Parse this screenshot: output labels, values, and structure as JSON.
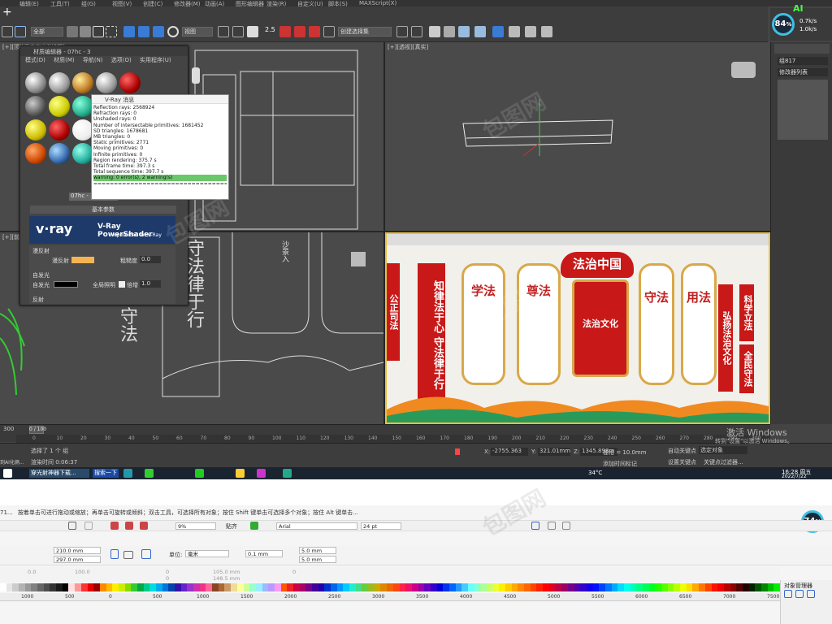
{
  "max": {
    "topbar": [
      "编辑(E)",
      "工具(T)",
      "组(G)",
      "视图(V)",
      "创建(C)",
      "修改器(M)",
      "动画(A)",
      "图形编辑器",
      "渲染(R)",
      "自定义(U)",
      "脚本(S)",
      "MAXScript(X)"
    ],
    "add_tab": "+",
    "selection_filter": "全部",
    "ref_coord": "视图",
    "named_selection": "创建选择集",
    "ai_label": "AI",
    "perf": {
      "percent": "84",
      "unit": "%",
      "up": "0.7k/s",
      "down": "1.0k/s"
    },
    "viewports": {
      "tl": "[+][顶][用户定义][线框]",
      "tr": "[+][透视][真实]",
      "bl": "[+][前][用户定义][线框]",
      "br": "[+][透视][真实]"
    },
    "command_panel": {
      "object_name": "组817",
      "modifier_list": "修改器列表"
    },
    "material_editor": {
      "title": "材质编辑器 - 07hc - 3",
      "menu": [
        "模式(D)",
        "材质(M)",
        "导航(N)",
        "选项(O)",
        "实用程序(U)"
      ],
      "slot_name": "07hc - 3",
      "basic_params": "基本参数",
      "diffuse_group": "漫反射",
      "diffuse_label": "漫反射",
      "roughness_label": "粗糙度",
      "roughness_value": "0.0",
      "self_illum_group": "自发光",
      "self_illum_label": "自发光",
      "gi_label": "全局照明",
      "multiplier_label": "倍增",
      "multiplier_value": "1.0",
      "reflection_group": "反射",
      "diffuse_color": "#f5b454"
    },
    "vray_message": {
      "title": "V-Ray 消息",
      "lines": [
        "Reflection rays: 2568924",
        "Refraction rays: 0",
        "Unshaded rays: 0",
        "Number of intersectable primitives: 1681452",
        "SD triangles: 1678681",
        "MB triangles: 0",
        "Static primitives: 2771",
        "Moving primitives: 0",
        "Infinite primitives: 0",
        "Region rendering: 375.7 s",
        "Total frame time: 397.3 s",
        "Total sequence time: 397.7 s"
      ],
      "warning": "warning: 0 error(s), 2 warning(s)",
      "separator": "=================================="
    },
    "vray_banner": {
      "logo": "v·ray",
      "product": "V-Ray PowerShader",
      "sub": "optimized for V-Ray"
    },
    "scene_text": {
      "top": "守法",
      "mid": "守法律于行",
      "label": "沙景入"
    },
    "board": {
      "header": "法治中国",
      "cols": [
        "学法",
        "尊法",
        "守法",
        "用法"
      ],
      "center": "法治文化",
      "left_bar": "知律法于心 守法律于行",
      "right_bar1": "弘扬法治文化",
      "right_bar2": "科学立法",
      "right_bar3": "全民守法",
      "edge_left": "公正司法"
    },
    "timeline": {
      "frame": "0 / 100",
      "ticks": [
        "0",
        "10",
        "20",
        "30",
        "40",
        "50",
        "60",
        "70",
        "80",
        "90",
        "100",
        "110",
        "120",
        "130",
        "140",
        "150",
        "160",
        "170",
        "180",
        "190",
        "200",
        "210",
        "220",
        "230",
        "240",
        "250",
        "260",
        "270",
        "280",
        "290",
        "300"
      ],
      "left_val": "300"
    },
    "status": {
      "selected": "选择了 1 个 组",
      "render_time": "渲染时间 0:06:37",
      "x_label": "X:",
      "x": "-2755.363",
      "y_label": "Y:",
      "y": "321.01mm",
      "z_label": "Z:",
      "z": "1345.898m",
      "grid": "栅格 = 10.0mm",
      "add_time_tag": "添加时间标记",
      "auto_key": "自动关键点",
      "selected_obj": "选定对象",
      "set_key": "设置关键点",
      "key_filter": "关键点过滤器...",
      "left_tag": "到AI化俩..."
    },
    "watermark_win": {
      "line1": "激活 Windows",
      "line2": "转到\"设置\"以激活 Windows。"
    },
    "taskbar": {
      "search": "搜索一下",
      "app": "穿光射神器下载...",
      "weather": "34°C",
      "time": "16:28 周五",
      "date": "2022/7/22"
    }
  },
  "cdr": {
    "hint": "按着单击可进行拖动或缩放；再单击可旋转或倾斜；双击工具，可选择所有对象；按住 Shift 键单击可选择多个对象；按住 Alt 键单击...",
    "hint_prefix": "71...",
    "zoom": "9%",
    "snap": "贴齐",
    "font": "Arial",
    "font_size": "24 pt",
    "width": "210.0 mm",
    "height": "297.0 mm",
    "unit_label": "单位:",
    "unit": "毫米",
    "nudge": "0.1 mm",
    "dup_x": "5.0 mm",
    "dup_y": "5.0 mm",
    "pos_values": [
      "0.0",
      "100.0",
      "0",
      "0",
      "105.0 mm",
      "148.5 mm",
      "0"
    ],
    "ruler": [
      "1000",
      "500",
      "0",
      "500",
      "1000",
      "1500",
      "2000",
      "2500",
      "3000",
      "3500",
      "4000",
      "4500",
      "5000",
      "5500",
      "6000",
      "6500",
      "7000",
      "7500"
    ],
    "gauge": "74",
    "gauge_unit": "%",
    "object_manager": "对象管理器"
  },
  "palette": [
    "#ffffff",
    "#e6e6e6",
    "#cccccc",
    "#b3b3b3",
    "#999999",
    "#808080",
    "#666666",
    "#4d4d4d",
    "#333333",
    "#1a1a1a",
    "#000000",
    "#ffe0e0",
    "#ff9999",
    "#ff3333",
    "#e60000",
    "#990000",
    "#ff8800",
    "#ffbb00",
    "#ffee00",
    "#ccee00",
    "#88dd00",
    "#33cc33",
    "#00aa44",
    "#00cc88",
    "#00dddd",
    "#00aaee",
    "#0077dd",
    "#0044aa",
    "#3311aa",
    "#6622cc",
    "#9933cc",
    "#cc33aa",
    "#ee3388",
    "#ff6699",
    "#884422",
    "#aa6633",
    "#cc9966",
    "#eedd99",
    "#ffff99",
    "#ccff99",
    "#99ffcc",
    "#99eeff",
    "#99bbff",
    "#bb99ff",
    "#ff99ee",
    "#ff5500",
    "#ee2222",
    "#cc0044",
    "#aa0066",
    "#770088",
    "#440099",
    "#2200aa",
    "#0033cc",
    "#0066ee",
    "#0099ff",
    "#00ccff",
    "#22eecc",
    "#44dd88",
    "#66cc44",
    "#99bb22",
    "#ccaa00",
    "#dd8800",
    "#ee6600",
    "#ff4411",
    "#ff2244",
    "#ee1166",
    "#cc0088",
    "#9900aa",
    "#6600bb",
    "#3300cc",
    "#0000dd",
    "#0033ee",
    "#0066ff",
    "#2299ff",
    "#44ccff",
    "#66ffff",
    "#88ffcc",
    "#aaff99",
    "#ccff66",
    "#eeff33",
    "#ffee00",
    "#ffcc00",
    "#ffaa00",
    "#ff8800",
    "#ff6600",
    "#ff4400",
    "#ff2200",
    "#ff0000",
    "#dd0022",
    "#bb0044",
    "#990066",
    "#770088",
    "#5500aa",
    "#3300cc",
    "#1100ee",
    "#0011ff",
    "#0044ff",
    "#0077ff",
    "#00aaff",
    "#00ddff",
    "#00ffee",
    "#00ffbb",
    "#00ff88",
    "#00ff55",
    "#00ff22",
    "#22ff00",
    "#55ff00",
    "#88ff00",
    "#bbff00",
    "#eeff00",
    "#ffdd00",
    "#ffaa00",
    "#ff7700",
    "#ff4400",
    "#ff1100",
    "#ee0000",
    "#bb0000",
    "#880000",
    "#550000",
    "#220000",
    "#002200",
    "#005500",
    "#008800",
    "#00bb00",
    "#00ee00"
  ]
}
